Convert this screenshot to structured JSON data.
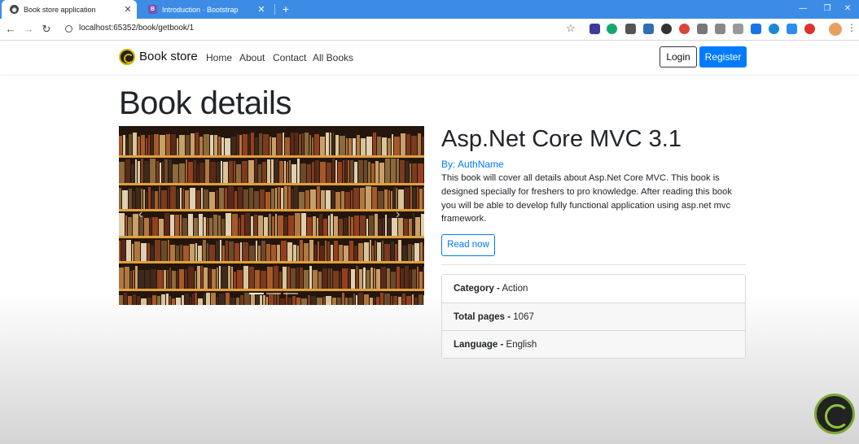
{
  "browser": {
    "tabs": [
      {
        "title": "Book store application",
        "active": true
      },
      {
        "title": "Introduction · Bootstrap",
        "active": false
      }
    ],
    "url": "localhost:65352/book/getbook/1",
    "new_tab": "+",
    "close": "✕"
  },
  "navbar": {
    "brand": "Book store",
    "links": [
      "Home",
      "About",
      "Contact",
      "All Books"
    ],
    "login": "Login",
    "register": "Register"
  },
  "page": {
    "heading": "Book details"
  },
  "book": {
    "title": "Asp.Net Core MVC 3.1",
    "author": "By: AuthName",
    "description": "This book will cover all details about Asp.Net Core MVC. This book is designed specially for freshers to pro knowledge. After reading this book you will be able to develop fully functional application using asp.net mvc framework.",
    "read_button": "Read now",
    "details": [
      {
        "label": "Category -",
        "value": "Action"
      },
      {
        "label": "Total pages -",
        "value": "1067"
      },
      {
        "label": "Language -",
        "value": "English"
      }
    ]
  },
  "carousel": {
    "prev": "‹",
    "next": "›"
  },
  "colors": {
    "primary": "#007bff",
    "tab_strip": "#3c8ce6"
  }
}
